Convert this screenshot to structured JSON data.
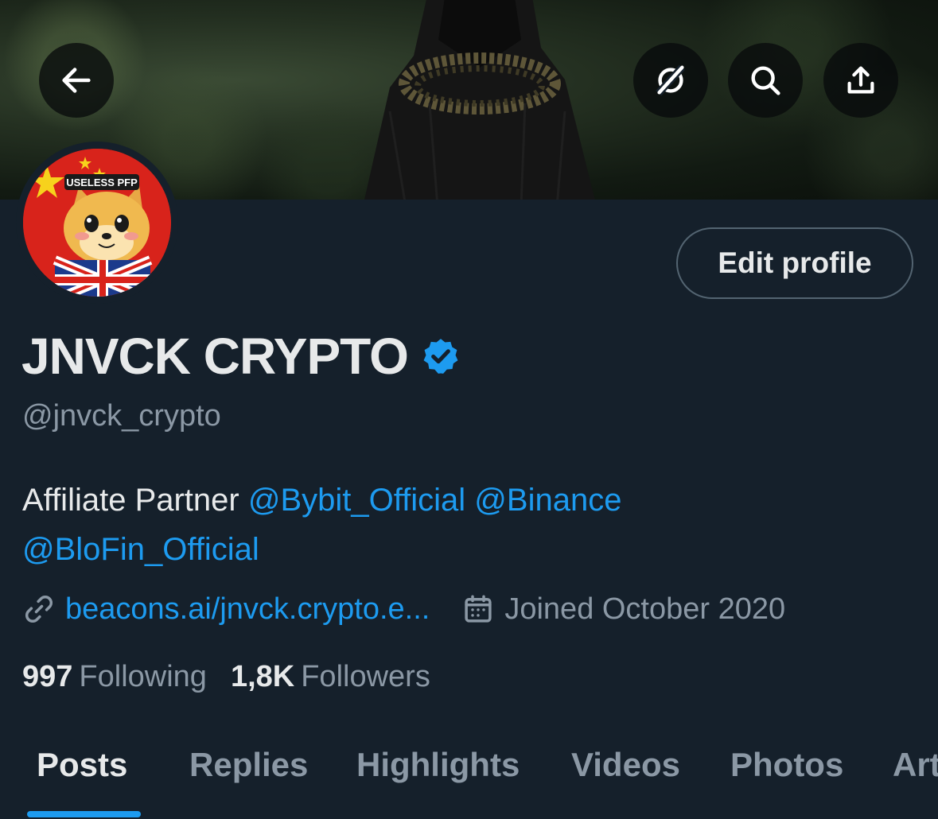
{
  "header": {
    "back_icon": "arrow-left-icon",
    "grok_icon": "grok-icon",
    "search_icon": "search-icon",
    "share_icon": "share-icon"
  },
  "avatar": {
    "text": "USELESS PFP"
  },
  "profile": {
    "edit_label": "Edit profile",
    "display_name": "JNVCK CRYPTO",
    "handle": "@jnvck_crypto",
    "bio_text": "Affiliate Partner ",
    "mentions": [
      "@Bybit_Official",
      "@Binance",
      "@BloFin_Official"
    ],
    "link": "beacons.ai/jnvck.crypto.e...",
    "joined": "Joined October 2020"
  },
  "stats": {
    "following_count": "997",
    "following_label": "Following",
    "followers_count": "1,8K",
    "followers_label": "Followers"
  },
  "tabs": [
    "Posts",
    "Replies",
    "Highlights",
    "Videos",
    "Photos",
    "Articles"
  ],
  "colors": {
    "background": "#15202b",
    "accent": "#1d9bf0",
    "text_primary": "#e7e9ea",
    "text_secondary": "#8b98a5"
  }
}
